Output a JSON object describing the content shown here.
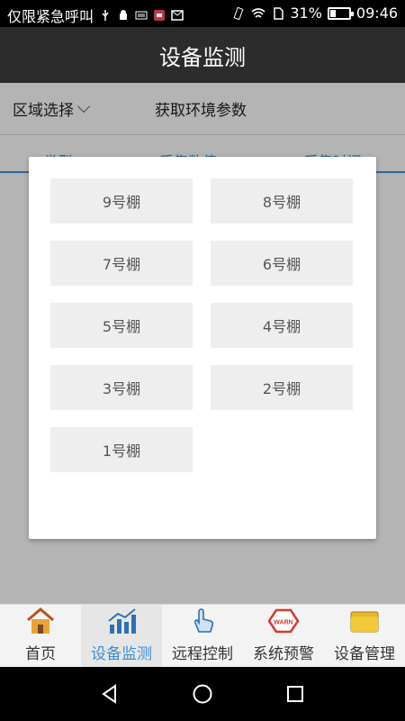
{
  "status_bar": {
    "carrier": "仅限紧急呼叫",
    "battery_pct": "31%",
    "battery_level": 0.31,
    "time": "09:46",
    "icons": [
      "usb-icon",
      "android-icon",
      "keyboard-icon",
      "app-badge-icon",
      "mail-icon",
      "vibrate-icon",
      "wifi-icon",
      "sim-icon",
      "battery-icon"
    ]
  },
  "title": "设备监测",
  "filter": {
    "region_label": "区域选择",
    "fetch_label": "获取环境参数"
  },
  "columns": [
    "类型",
    "采集数值",
    "采集时间"
  ],
  "dialog": {
    "sheds": [
      "9号棚",
      "8号棚",
      "7号棚",
      "6号棚",
      "5号棚",
      "4号棚",
      "3号棚",
      "2号棚",
      "1号棚"
    ]
  },
  "tabs": [
    {
      "label": "首页",
      "icon": "home-icon"
    },
    {
      "label": "设备监测",
      "icon": "chart-icon",
      "active": true
    },
    {
      "label": "远程控制",
      "icon": "hand-touch-icon"
    },
    {
      "label": "系统预警",
      "icon": "warn-icon"
    },
    {
      "label": "设备管理",
      "icon": "folder-icon"
    }
  ],
  "nav": [
    "back-icon",
    "home-circle-icon",
    "recents-icon"
  ],
  "colors": {
    "accent": "#3b8fd6",
    "title_bg": "#2c2c2c"
  }
}
